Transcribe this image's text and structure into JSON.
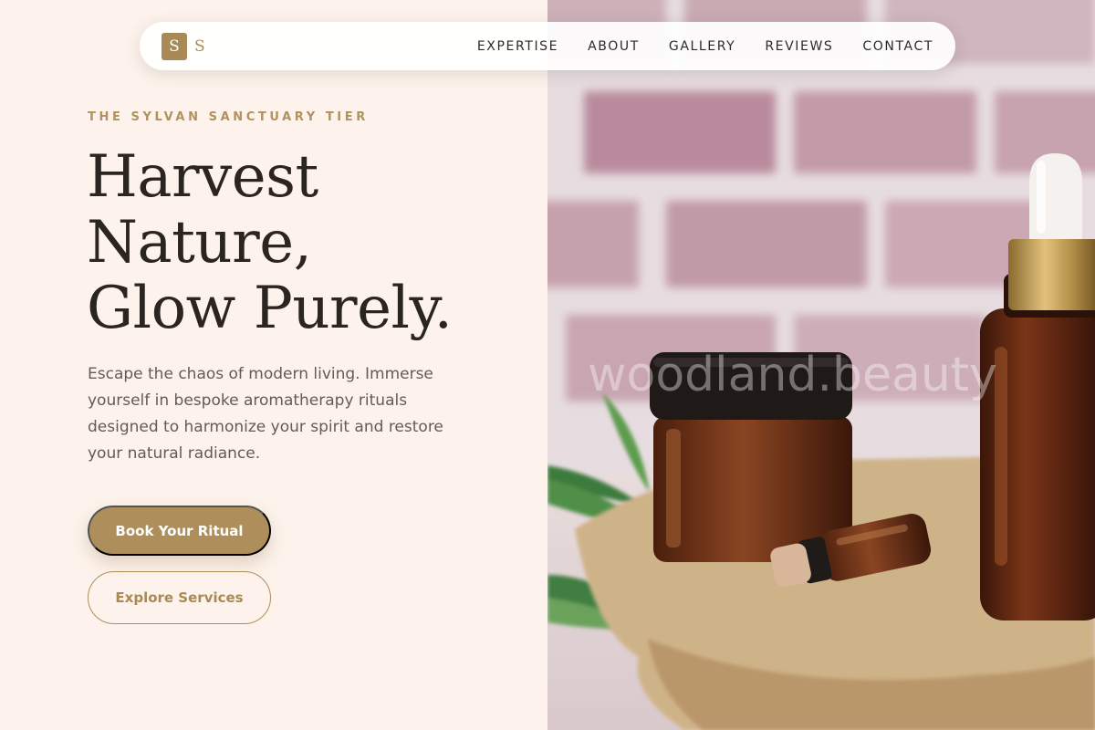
{
  "brand": {
    "logo_letter": "S",
    "logo_text": "S",
    "accent": "#ae8f5c"
  },
  "nav": {
    "links": [
      {
        "label": "EXPERTISE"
      },
      {
        "label": "ABOUT"
      },
      {
        "label": "GALLERY"
      },
      {
        "label": "REVIEWS"
      },
      {
        "label": "CONTACT"
      }
    ]
  },
  "hero": {
    "eyebrow": "THE SYLVAN SANCTUARY TIER",
    "headline_lines": [
      "Harvest",
      "Nature,",
      "Glow Purely."
    ],
    "intro": "Escape the chaos of modern living. Immerse yourself in bespoke aromatherapy rituals designed to harmonize your spirit and restore your natural radiance.",
    "primary_cta": "Book Your Ritual",
    "secondary_cta": "Explore Services"
  },
  "image": {
    "watermark": "woodland.beauty"
  },
  "colors": {
    "page_bg": "#fdf3ec",
    "heading": "#2b2522",
    "body_text": "#655a55",
    "eyebrow": "#b0915f"
  }
}
